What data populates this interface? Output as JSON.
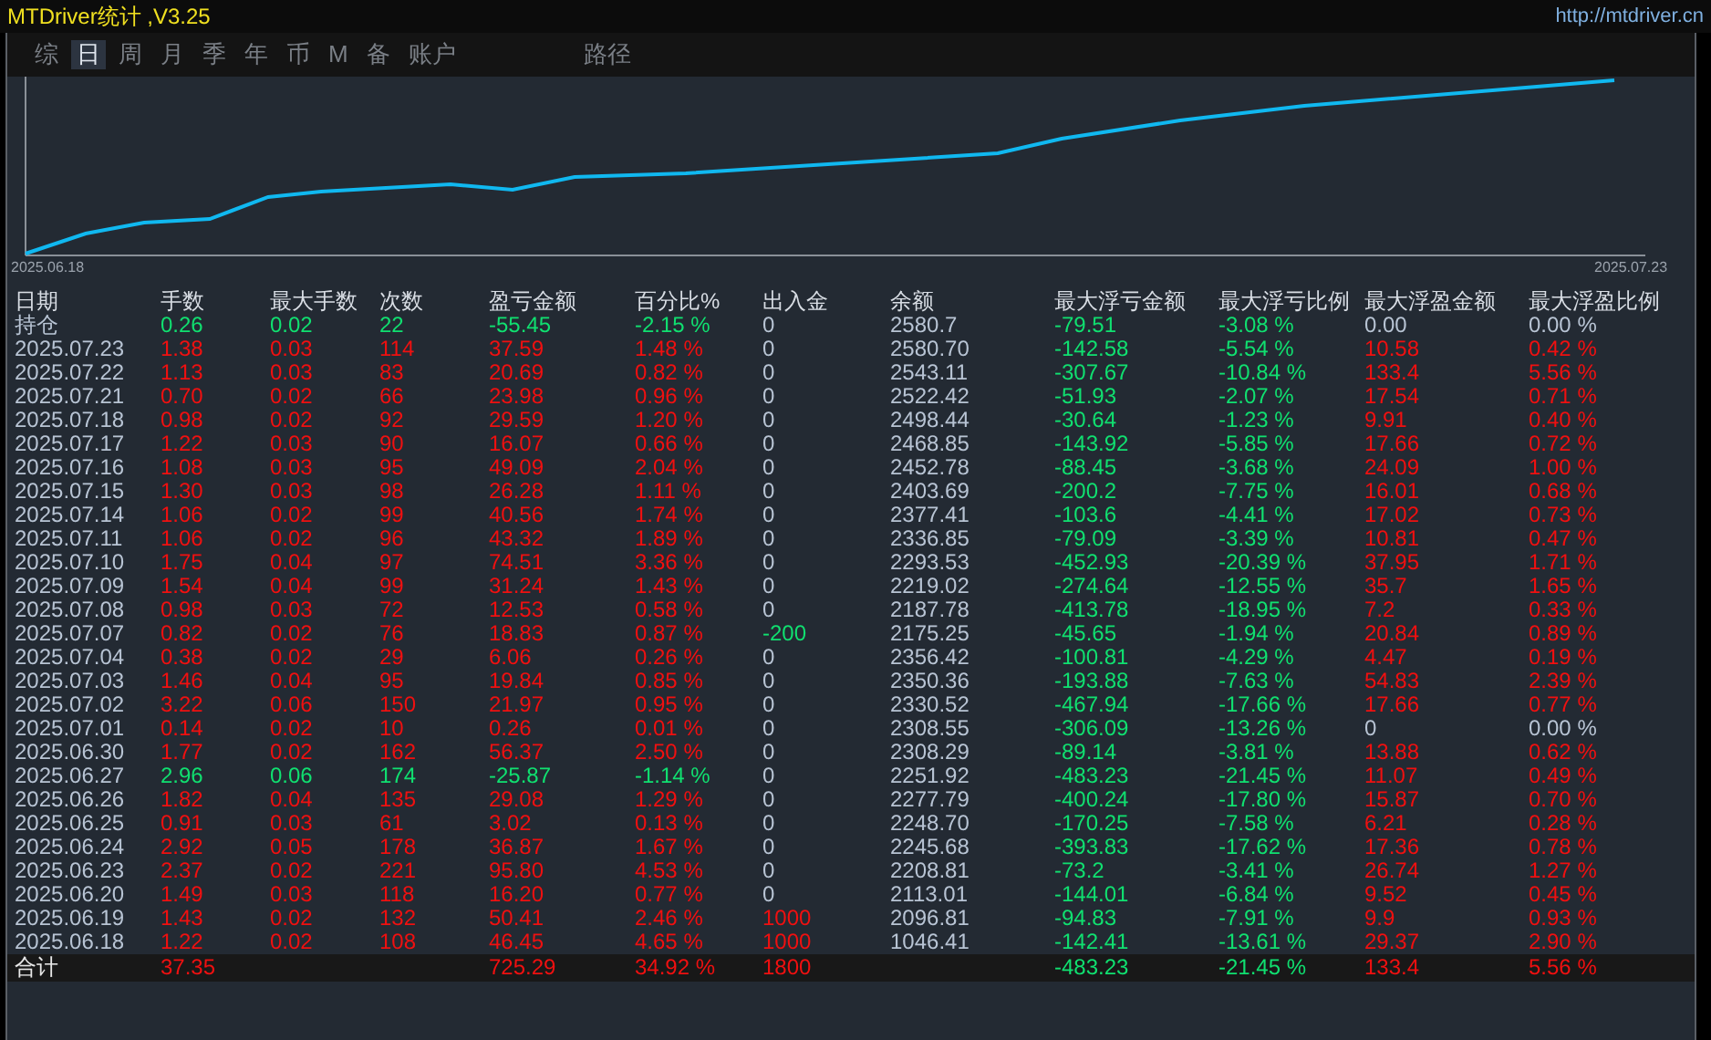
{
  "window": {
    "title": "MTDriver统计 ,V3.25",
    "link": "http://mtdriver.cn"
  },
  "tabs": [
    {
      "label": "综",
      "selected": false
    },
    {
      "label": "日",
      "selected": true
    },
    {
      "label": "周",
      "selected": false
    },
    {
      "label": "月",
      "selected": false
    },
    {
      "label": "季",
      "selected": false
    },
    {
      "label": "年",
      "selected": false
    },
    {
      "label": "币",
      "selected": false
    },
    {
      "label": "M",
      "selected": false
    },
    {
      "label": "备",
      "selected": false
    },
    {
      "label": "账户",
      "selected": false
    },
    {
      "label": "路径",
      "selected": false
    }
  ],
  "chart": {
    "start_label": "2025.06.18",
    "end_label": "2025.07.23"
  },
  "table": {
    "columns": [
      "日期",
      "手数",
      "最大手数",
      "次数",
      "盈亏金额",
      "百分比%",
      "出入金",
      "余额",
      "最大浮亏金额",
      "最大浮亏比例",
      "最大浮盈金额",
      "最大浮盈比例"
    ],
    "rows": [
      {
        "cells": [
          {
            "text": "持仓",
            "kind": "plain"
          },
          {
            "text": "0.26",
            "kind": "loss"
          },
          {
            "text": "0.02",
            "kind": "loss"
          },
          {
            "text": "22",
            "kind": "loss"
          },
          {
            "text": "-55.45",
            "kind": "loss"
          },
          {
            "text": "-2.15 %",
            "kind": "loss"
          },
          {
            "text": "0",
            "kind": "plain"
          },
          {
            "text": "2580.7",
            "kind": "plain"
          },
          {
            "text": "-79.51",
            "kind": "loss"
          },
          {
            "text": "-3.08 %",
            "kind": "loss"
          },
          {
            "text": "0.00",
            "kind": "plain"
          },
          {
            "text": "0.00 %",
            "kind": "plain"
          }
        ]
      },
      {
        "cells": [
          {
            "text": "2025.07.23",
            "kind": "plain"
          },
          {
            "text": "1.38",
            "kind": "profit"
          },
          {
            "text": "0.03",
            "kind": "profit"
          },
          {
            "text": "114",
            "kind": "profit"
          },
          {
            "text": "37.59",
            "kind": "profit"
          },
          {
            "text": "1.48 %",
            "kind": "profit"
          },
          {
            "text": "0",
            "kind": "plain"
          },
          {
            "text": "2580.70",
            "kind": "plain"
          },
          {
            "text": "-142.58",
            "kind": "loss"
          },
          {
            "text": "-5.54 %",
            "kind": "loss"
          },
          {
            "text": "10.58",
            "kind": "profit"
          },
          {
            "text": "0.42 %",
            "kind": "profit"
          }
        ]
      },
      {
        "cells": [
          {
            "text": "2025.07.22",
            "kind": "plain"
          },
          {
            "text": "1.13",
            "kind": "profit"
          },
          {
            "text": "0.03",
            "kind": "profit"
          },
          {
            "text": "83",
            "kind": "profit"
          },
          {
            "text": "20.69",
            "kind": "profit"
          },
          {
            "text": "0.82 %",
            "kind": "profit"
          },
          {
            "text": "0",
            "kind": "plain"
          },
          {
            "text": "2543.11",
            "kind": "plain"
          },
          {
            "text": "-307.67",
            "kind": "loss"
          },
          {
            "text": "-10.84 %",
            "kind": "loss"
          },
          {
            "text": "133.4",
            "kind": "profit"
          },
          {
            "text": "5.56 %",
            "kind": "profit"
          }
        ]
      },
      {
        "cells": [
          {
            "text": "2025.07.21",
            "kind": "plain"
          },
          {
            "text": "0.70",
            "kind": "profit"
          },
          {
            "text": "0.02",
            "kind": "profit"
          },
          {
            "text": "66",
            "kind": "profit"
          },
          {
            "text": "23.98",
            "kind": "profit"
          },
          {
            "text": "0.96 %",
            "kind": "profit"
          },
          {
            "text": "0",
            "kind": "plain"
          },
          {
            "text": "2522.42",
            "kind": "plain"
          },
          {
            "text": "-51.93",
            "kind": "loss"
          },
          {
            "text": "-2.07 %",
            "kind": "loss"
          },
          {
            "text": "17.54",
            "kind": "profit"
          },
          {
            "text": "0.71 %",
            "kind": "profit"
          }
        ]
      },
      {
        "cells": [
          {
            "text": "2025.07.18",
            "kind": "plain"
          },
          {
            "text": "0.98",
            "kind": "profit"
          },
          {
            "text": "0.02",
            "kind": "profit"
          },
          {
            "text": "92",
            "kind": "profit"
          },
          {
            "text": "29.59",
            "kind": "profit"
          },
          {
            "text": "1.20 %",
            "kind": "profit"
          },
          {
            "text": "0",
            "kind": "plain"
          },
          {
            "text": "2498.44",
            "kind": "plain"
          },
          {
            "text": "-30.64",
            "kind": "loss"
          },
          {
            "text": "-1.23 %",
            "kind": "loss"
          },
          {
            "text": "9.91",
            "kind": "profit"
          },
          {
            "text": "0.40 %",
            "kind": "profit"
          }
        ]
      },
      {
        "cells": [
          {
            "text": "2025.07.17",
            "kind": "plain"
          },
          {
            "text": "1.22",
            "kind": "profit"
          },
          {
            "text": "0.03",
            "kind": "profit"
          },
          {
            "text": "90",
            "kind": "profit"
          },
          {
            "text": "16.07",
            "kind": "profit"
          },
          {
            "text": "0.66 %",
            "kind": "profit"
          },
          {
            "text": "0",
            "kind": "plain"
          },
          {
            "text": "2468.85",
            "kind": "plain"
          },
          {
            "text": "-143.92",
            "kind": "loss"
          },
          {
            "text": "-5.85 %",
            "kind": "loss"
          },
          {
            "text": "17.66",
            "kind": "profit"
          },
          {
            "text": "0.72 %",
            "kind": "profit"
          }
        ]
      },
      {
        "cells": [
          {
            "text": "2025.07.16",
            "kind": "plain"
          },
          {
            "text": "1.08",
            "kind": "profit"
          },
          {
            "text": "0.03",
            "kind": "profit"
          },
          {
            "text": "95",
            "kind": "profit"
          },
          {
            "text": "49.09",
            "kind": "profit"
          },
          {
            "text": "2.04 %",
            "kind": "profit"
          },
          {
            "text": "0",
            "kind": "plain"
          },
          {
            "text": "2452.78",
            "kind": "plain"
          },
          {
            "text": "-88.45",
            "kind": "loss"
          },
          {
            "text": "-3.68 %",
            "kind": "loss"
          },
          {
            "text": "24.09",
            "kind": "profit"
          },
          {
            "text": "1.00 %",
            "kind": "profit"
          }
        ]
      },
      {
        "cells": [
          {
            "text": "2025.07.15",
            "kind": "plain"
          },
          {
            "text": "1.30",
            "kind": "profit"
          },
          {
            "text": "0.03",
            "kind": "profit"
          },
          {
            "text": "98",
            "kind": "profit"
          },
          {
            "text": "26.28",
            "kind": "profit"
          },
          {
            "text": "1.11 %",
            "kind": "profit"
          },
          {
            "text": "0",
            "kind": "plain"
          },
          {
            "text": "2403.69",
            "kind": "plain"
          },
          {
            "text": "-200.2",
            "kind": "loss"
          },
          {
            "text": "-7.75 %",
            "kind": "loss"
          },
          {
            "text": "16.01",
            "kind": "profit"
          },
          {
            "text": "0.68 %",
            "kind": "profit"
          }
        ]
      },
      {
        "cells": [
          {
            "text": "2025.07.14",
            "kind": "plain"
          },
          {
            "text": "1.06",
            "kind": "profit"
          },
          {
            "text": "0.02",
            "kind": "profit"
          },
          {
            "text": "99",
            "kind": "profit"
          },
          {
            "text": "40.56",
            "kind": "profit"
          },
          {
            "text": "1.74 %",
            "kind": "profit"
          },
          {
            "text": "0",
            "kind": "plain"
          },
          {
            "text": "2377.41",
            "kind": "plain"
          },
          {
            "text": "-103.6",
            "kind": "loss"
          },
          {
            "text": "-4.41 %",
            "kind": "loss"
          },
          {
            "text": "17.02",
            "kind": "profit"
          },
          {
            "text": "0.73 %",
            "kind": "profit"
          }
        ]
      },
      {
        "cells": [
          {
            "text": "2025.07.11",
            "kind": "plain"
          },
          {
            "text": "1.06",
            "kind": "profit"
          },
          {
            "text": "0.02",
            "kind": "profit"
          },
          {
            "text": "96",
            "kind": "profit"
          },
          {
            "text": "43.32",
            "kind": "profit"
          },
          {
            "text": "1.89 %",
            "kind": "profit"
          },
          {
            "text": "0",
            "kind": "plain"
          },
          {
            "text": "2336.85",
            "kind": "plain"
          },
          {
            "text": "-79.09",
            "kind": "loss"
          },
          {
            "text": "-3.39 %",
            "kind": "loss"
          },
          {
            "text": "10.81",
            "kind": "profit"
          },
          {
            "text": "0.47 %",
            "kind": "profit"
          }
        ]
      },
      {
        "cells": [
          {
            "text": "2025.07.10",
            "kind": "plain"
          },
          {
            "text": "1.75",
            "kind": "profit"
          },
          {
            "text": "0.04",
            "kind": "profit"
          },
          {
            "text": "97",
            "kind": "profit"
          },
          {
            "text": "74.51",
            "kind": "profit"
          },
          {
            "text": "3.36 %",
            "kind": "profit"
          },
          {
            "text": "0",
            "kind": "plain"
          },
          {
            "text": "2293.53",
            "kind": "plain"
          },
          {
            "text": "-452.93",
            "kind": "loss"
          },
          {
            "text": "-20.39 %",
            "kind": "loss"
          },
          {
            "text": "37.95",
            "kind": "profit"
          },
          {
            "text": "1.71 %",
            "kind": "profit"
          }
        ]
      },
      {
        "cells": [
          {
            "text": "2025.07.09",
            "kind": "plain"
          },
          {
            "text": "1.54",
            "kind": "profit"
          },
          {
            "text": "0.04",
            "kind": "profit"
          },
          {
            "text": "99",
            "kind": "profit"
          },
          {
            "text": "31.24",
            "kind": "profit"
          },
          {
            "text": "1.43 %",
            "kind": "profit"
          },
          {
            "text": "0",
            "kind": "plain"
          },
          {
            "text": "2219.02",
            "kind": "plain"
          },
          {
            "text": "-274.64",
            "kind": "loss"
          },
          {
            "text": "-12.55 %",
            "kind": "loss"
          },
          {
            "text": "35.7",
            "kind": "profit"
          },
          {
            "text": "1.65 %",
            "kind": "profit"
          }
        ]
      },
      {
        "cells": [
          {
            "text": "2025.07.08",
            "kind": "plain"
          },
          {
            "text": "0.98",
            "kind": "profit"
          },
          {
            "text": "0.03",
            "kind": "profit"
          },
          {
            "text": "72",
            "kind": "profit"
          },
          {
            "text": "12.53",
            "kind": "profit"
          },
          {
            "text": "0.58 %",
            "kind": "profit"
          },
          {
            "text": "0",
            "kind": "plain"
          },
          {
            "text": "2187.78",
            "kind": "plain"
          },
          {
            "text": "-413.78",
            "kind": "loss"
          },
          {
            "text": "-18.95 %",
            "kind": "loss"
          },
          {
            "text": "7.2",
            "kind": "profit"
          },
          {
            "text": "0.33 %",
            "kind": "profit"
          }
        ]
      },
      {
        "cells": [
          {
            "text": "2025.07.07",
            "kind": "plain"
          },
          {
            "text": "0.82",
            "kind": "profit"
          },
          {
            "text": "0.02",
            "kind": "profit"
          },
          {
            "text": "76",
            "kind": "profit"
          },
          {
            "text": "18.83",
            "kind": "profit"
          },
          {
            "text": "0.87 %",
            "kind": "profit"
          },
          {
            "text": "-200",
            "kind": "loss"
          },
          {
            "text": "2175.25",
            "kind": "plain"
          },
          {
            "text": "-45.65",
            "kind": "loss"
          },
          {
            "text": "-1.94 %",
            "kind": "loss"
          },
          {
            "text": "20.84",
            "kind": "profit"
          },
          {
            "text": "0.89 %",
            "kind": "profit"
          }
        ]
      },
      {
        "cells": [
          {
            "text": "2025.07.04",
            "kind": "plain"
          },
          {
            "text": "0.38",
            "kind": "profit"
          },
          {
            "text": "0.02",
            "kind": "profit"
          },
          {
            "text": "29",
            "kind": "profit"
          },
          {
            "text": "6.06",
            "kind": "profit"
          },
          {
            "text": "0.26 %",
            "kind": "profit"
          },
          {
            "text": "0",
            "kind": "plain"
          },
          {
            "text": "2356.42",
            "kind": "plain"
          },
          {
            "text": "-100.81",
            "kind": "loss"
          },
          {
            "text": "-4.29 %",
            "kind": "loss"
          },
          {
            "text": "4.47",
            "kind": "profit"
          },
          {
            "text": "0.19 %",
            "kind": "profit"
          }
        ]
      },
      {
        "cells": [
          {
            "text": "2025.07.03",
            "kind": "plain"
          },
          {
            "text": "1.46",
            "kind": "profit"
          },
          {
            "text": "0.04",
            "kind": "profit"
          },
          {
            "text": "95",
            "kind": "profit"
          },
          {
            "text": "19.84",
            "kind": "profit"
          },
          {
            "text": "0.85 %",
            "kind": "profit"
          },
          {
            "text": "0",
            "kind": "plain"
          },
          {
            "text": "2350.36",
            "kind": "plain"
          },
          {
            "text": "-193.88",
            "kind": "loss"
          },
          {
            "text": "-7.63 %",
            "kind": "loss"
          },
          {
            "text": "54.83",
            "kind": "profit"
          },
          {
            "text": "2.39 %",
            "kind": "profit"
          }
        ]
      },
      {
        "cells": [
          {
            "text": "2025.07.02",
            "kind": "plain"
          },
          {
            "text": "3.22",
            "kind": "profit"
          },
          {
            "text": "0.06",
            "kind": "profit"
          },
          {
            "text": "150",
            "kind": "profit"
          },
          {
            "text": "21.97",
            "kind": "profit"
          },
          {
            "text": "0.95 %",
            "kind": "profit"
          },
          {
            "text": "0",
            "kind": "plain"
          },
          {
            "text": "2330.52",
            "kind": "plain"
          },
          {
            "text": "-467.94",
            "kind": "loss"
          },
          {
            "text": "-17.66 %",
            "kind": "loss"
          },
          {
            "text": "17.66",
            "kind": "profit"
          },
          {
            "text": "0.77 %",
            "kind": "profit"
          }
        ]
      },
      {
        "cells": [
          {
            "text": "2025.07.01",
            "kind": "plain"
          },
          {
            "text": "0.14",
            "kind": "profit"
          },
          {
            "text": "0.02",
            "kind": "profit"
          },
          {
            "text": "10",
            "kind": "profit"
          },
          {
            "text": "0.26",
            "kind": "profit"
          },
          {
            "text": "0.01 %",
            "kind": "profit"
          },
          {
            "text": "0",
            "kind": "plain"
          },
          {
            "text": "2308.55",
            "kind": "plain"
          },
          {
            "text": "-306.09",
            "kind": "loss"
          },
          {
            "text": "-13.26 %",
            "kind": "loss"
          },
          {
            "text": "0",
            "kind": "plain"
          },
          {
            "text": "0.00 %",
            "kind": "plain"
          }
        ]
      },
      {
        "cells": [
          {
            "text": "2025.06.30",
            "kind": "plain"
          },
          {
            "text": "1.77",
            "kind": "profit"
          },
          {
            "text": "0.02",
            "kind": "profit"
          },
          {
            "text": "162",
            "kind": "profit"
          },
          {
            "text": "56.37",
            "kind": "profit"
          },
          {
            "text": "2.50 %",
            "kind": "profit"
          },
          {
            "text": "0",
            "kind": "plain"
          },
          {
            "text": "2308.29",
            "kind": "plain"
          },
          {
            "text": "-89.14",
            "kind": "loss"
          },
          {
            "text": "-3.81 %",
            "kind": "loss"
          },
          {
            "text": "13.88",
            "kind": "profit"
          },
          {
            "text": "0.62 %",
            "kind": "profit"
          }
        ]
      },
      {
        "cells": [
          {
            "text": "2025.06.27",
            "kind": "plain"
          },
          {
            "text": "2.96",
            "kind": "loss"
          },
          {
            "text": "0.06",
            "kind": "loss"
          },
          {
            "text": "174",
            "kind": "loss"
          },
          {
            "text": "-25.87",
            "kind": "loss"
          },
          {
            "text": "-1.14 %",
            "kind": "loss"
          },
          {
            "text": "0",
            "kind": "plain"
          },
          {
            "text": "2251.92",
            "kind": "plain"
          },
          {
            "text": "-483.23",
            "kind": "loss"
          },
          {
            "text": "-21.45 %",
            "kind": "loss"
          },
          {
            "text": "11.07",
            "kind": "profit"
          },
          {
            "text": "0.49 %",
            "kind": "profit"
          }
        ]
      },
      {
        "cells": [
          {
            "text": "2025.06.26",
            "kind": "plain"
          },
          {
            "text": "1.82",
            "kind": "profit"
          },
          {
            "text": "0.04",
            "kind": "profit"
          },
          {
            "text": "135",
            "kind": "profit"
          },
          {
            "text": "29.08",
            "kind": "profit"
          },
          {
            "text": "1.29 %",
            "kind": "profit"
          },
          {
            "text": "0",
            "kind": "plain"
          },
          {
            "text": "2277.79",
            "kind": "plain"
          },
          {
            "text": "-400.24",
            "kind": "loss"
          },
          {
            "text": "-17.80 %",
            "kind": "loss"
          },
          {
            "text": "15.87",
            "kind": "profit"
          },
          {
            "text": "0.70 %",
            "kind": "profit"
          }
        ]
      },
      {
        "cells": [
          {
            "text": "2025.06.25",
            "kind": "plain"
          },
          {
            "text": "0.91",
            "kind": "profit"
          },
          {
            "text": "0.03",
            "kind": "profit"
          },
          {
            "text": "61",
            "kind": "profit"
          },
          {
            "text": "3.02",
            "kind": "profit"
          },
          {
            "text": "0.13 %",
            "kind": "profit"
          },
          {
            "text": "0",
            "kind": "plain"
          },
          {
            "text": "2248.70",
            "kind": "plain"
          },
          {
            "text": "-170.25",
            "kind": "loss"
          },
          {
            "text": "-7.58 %",
            "kind": "loss"
          },
          {
            "text": "6.21",
            "kind": "profit"
          },
          {
            "text": "0.28 %",
            "kind": "profit"
          }
        ]
      },
      {
        "cells": [
          {
            "text": "2025.06.24",
            "kind": "plain"
          },
          {
            "text": "2.92",
            "kind": "profit"
          },
          {
            "text": "0.05",
            "kind": "profit"
          },
          {
            "text": "178",
            "kind": "profit"
          },
          {
            "text": "36.87",
            "kind": "profit"
          },
          {
            "text": "1.67 %",
            "kind": "profit"
          },
          {
            "text": "0",
            "kind": "plain"
          },
          {
            "text": "2245.68",
            "kind": "plain"
          },
          {
            "text": "-393.83",
            "kind": "loss"
          },
          {
            "text": "-17.62 %",
            "kind": "loss"
          },
          {
            "text": "17.36",
            "kind": "profit"
          },
          {
            "text": "0.78 %",
            "kind": "profit"
          }
        ]
      },
      {
        "cells": [
          {
            "text": "2025.06.23",
            "kind": "plain"
          },
          {
            "text": "2.37",
            "kind": "profit"
          },
          {
            "text": "0.02",
            "kind": "profit"
          },
          {
            "text": "221",
            "kind": "profit"
          },
          {
            "text": "95.80",
            "kind": "profit"
          },
          {
            "text": "4.53 %",
            "kind": "profit"
          },
          {
            "text": "0",
            "kind": "plain"
          },
          {
            "text": "2208.81",
            "kind": "plain"
          },
          {
            "text": "-73.2",
            "kind": "loss"
          },
          {
            "text": "-3.41 %",
            "kind": "loss"
          },
          {
            "text": "26.74",
            "kind": "profit"
          },
          {
            "text": "1.27 %",
            "kind": "profit"
          }
        ]
      },
      {
        "cells": [
          {
            "text": "2025.06.20",
            "kind": "plain"
          },
          {
            "text": "1.49",
            "kind": "profit"
          },
          {
            "text": "0.03",
            "kind": "profit"
          },
          {
            "text": "118",
            "kind": "profit"
          },
          {
            "text": "16.20",
            "kind": "profit"
          },
          {
            "text": "0.77 %",
            "kind": "profit"
          },
          {
            "text": "0",
            "kind": "plain"
          },
          {
            "text": "2113.01",
            "kind": "plain"
          },
          {
            "text": "-144.01",
            "kind": "loss"
          },
          {
            "text": "-6.84 %",
            "kind": "loss"
          },
          {
            "text": "9.52",
            "kind": "profit"
          },
          {
            "text": "0.45 %",
            "kind": "profit"
          }
        ]
      },
      {
        "cells": [
          {
            "text": "2025.06.19",
            "kind": "plain"
          },
          {
            "text": "1.43",
            "kind": "profit"
          },
          {
            "text": "0.02",
            "kind": "profit"
          },
          {
            "text": "132",
            "kind": "profit"
          },
          {
            "text": "50.41",
            "kind": "profit"
          },
          {
            "text": "2.46 %",
            "kind": "profit"
          },
          {
            "text": "1000",
            "kind": "profit"
          },
          {
            "text": "2096.81",
            "kind": "plain"
          },
          {
            "text": "-94.83",
            "kind": "loss"
          },
          {
            "text": "-7.91 %",
            "kind": "loss"
          },
          {
            "text": "9.9",
            "kind": "profit"
          },
          {
            "text": "0.93 %",
            "kind": "profit"
          }
        ]
      },
      {
        "cells": [
          {
            "text": "2025.06.18",
            "kind": "plain"
          },
          {
            "text": "1.22",
            "kind": "profit"
          },
          {
            "text": "0.02",
            "kind": "profit"
          },
          {
            "text": "108",
            "kind": "profit"
          },
          {
            "text": "46.45",
            "kind": "profit"
          },
          {
            "text": "4.65 %",
            "kind": "profit"
          },
          {
            "text": "1000",
            "kind": "profit"
          },
          {
            "text": "1046.41",
            "kind": "plain"
          },
          {
            "text": "-142.41",
            "kind": "loss"
          },
          {
            "text": "-13.61 %",
            "kind": "loss"
          },
          {
            "text": "29.37",
            "kind": "profit"
          },
          {
            "text": "2.90 %",
            "kind": "profit"
          }
        ]
      }
    ],
    "total": {
      "cells": [
        {
          "text": "合计",
          "kind": "label"
        },
        {
          "text": "37.35",
          "kind": "profit"
        },
        {
          "kind": "blank"
        },
        {
          "kind": "blank"
        },
        {
          "text": "725.29",
          "kind": "profit"
        },
        {
          "text": "34.92 %",
          "kind": "profit"
        },
        {
          "text": "1800",
          "kind": "profit"
        },
        {
          "kind": "blank"
        },
        {
          "text": "-483.23",
          "kind": "loss"
        },
        {
          "text": "-21.45 %",
          "kind": "loss"
        },
        {
          "text": "133.4",
          "kind": "profit"
        },
        {
          "text": "5.56 %",
          "kind": "profit"
        }
      ]
    }
  }
}
